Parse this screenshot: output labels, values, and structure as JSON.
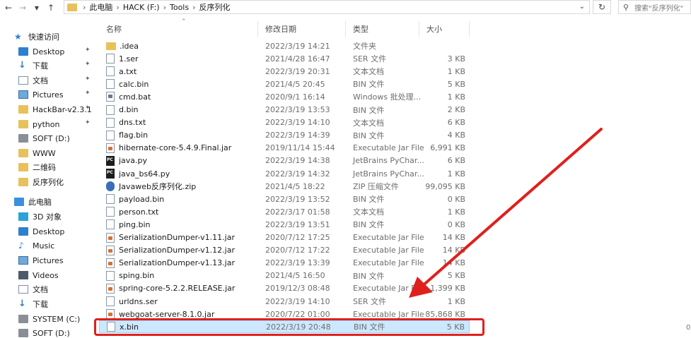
{
  "address_bar": {
    "crumbs": [
      "此电脑",
      "HACK (F:)",
      "Tools",
      "反序列化"
    ],
    "search_placeholder": "搜索\"反序列化\""
  },
  "sidebar": {
    "items": [
      {
        "label": "快速访问",
        "icon": "star-icon",
        "pinned": false
      },
      {
        "label": "Desktop",
        "icon": "desktop-icon",
        "pinned": true
      },
      {
        "label": "下载",
        "icon": "download-icon",
        "pinned": true
      },
      {
        "label": "文档",
        "icon": "documents-icon",
        "pinned": true
      },
      {
        "label": "Pictures",
        "icon": "pictures-icon",
        "pinned": true
      },
      {
        "label": "HackBar-v2.3.1",
        "icon": "folder-icon",
        "pinned": true
      },
      {
        "label": "python",
        "icon": "folder-icon",
        "pinned": true
      },
      {
        "label": "SOFT (D:)",
        "icon": "drive-icon",
        "pinned": false
      },
      {
        "label": "WWW",
        "icon": "folder-icon",
        "pinned": false
      },
      {
        "label": "二维码",
        "icon": "folder-icon",
        "pinned": false
      },
      {
        "label": "反序列化",
        "icon": "folder-icon",
        "pinned": false
      },
      {
        "label": "此电脑",
        "icon": "computer-icon",
        "pinned": false
      },
      {
        "label": "3D 对象",
        "icon": "3d-objects-icon",
        "pinned": false
      },
      {
        "label": "Desktop",
        "icon": "desktop-icon",
        "pinned": false
      },
      {
        "label": "Music",
        "icon": "music-icon",
        "pinned": false
      },
      {
        "label": "Pictures",
        "icon": "pictures-icon",
        "pinned": false
      },
      {
        "label": "Videos",
        "icon": "videos-icon",
        "pinned": false
      },
      {
        "label": "文档",
        "icon": "documents-icon",
        "pinned": false
      },
      {
        "label": "下载",
        "icon": "download-icon",
        "pinned": false
      },
      {
        "label": "SYSTEM (C:)",
        "icon": "drive-icon",
        "pinned": false
      },
      {
        "label": "SOFT (D:)",
        "icon": "drive-icon",
        "pinned": false
      }
    ]
  },
  "columns": {
    "name": "名称",
    "date": "修改日期",
    "type": "类型",
    "size": "大小"
  },
  "files": [
    {
      "name": ".idea",
      "date": "2022/3/19 14:21",
      "type": "文件夹",
      "size": "",
      "icon": "folder"
    },
    {
      "name": "1.ser",
      "date": "2021/4/28 16:47",
      "type": "SER 文件",
      "size": "3 KB",
      "icon": "file"
    },
    {
      "name": "a.txt",
      "date": "2022/3/19 20:31",
      "type": "文本文档",
      "size": "1 KB",
      "icon": "file"
    },
    {
      "name": "calc.bin",
      "date": "2021/4/5 20:45",
      "type": "BIN 文件",
      "size": "5 KB",
      "icon": "file"
    },
    {
      "name": "cmd.bat",
      "date": "2020/9/1 16:14",
      "type": "Windows 批处理...",
      "size": "1 KB",
      "icon": "bat"
    },
    {
      "name": "d.bin",
      "date": "2022/3/19 13:53",
      "type": "BIN 文件",
      "size": "2 KB",
      "icon": "file"
    },
    {
      "name": "dns.txt",
      "date": "2022/3/19 14:10",
      "type": "文本文档",
      "size": "6 KB",
      "icon": "file"
    },
    {
      "name": "flag.bin",
      "date": "2022/3/19 14:39",
      "type": "BIN 文件",
      "size": "4 KB",
      "icon": "file"
    },
    {
      "name": "hibernate-core-5.4.9.Final.jar",
      "date": "2019/11/14 15:44",
      "type": "Executable Jar File",
      "size": "6,991 KB",
      "icon": "jar"
    },
    {
      "name": "java.py",
      "date": "2022/3/19 14:38",
      "type": "JetBrains PyChar...",
      "size": "6 KB",
      "icon": "py"
    },
    {
      "name": "java_bs64.py",
      "date": "2022/3/19 14:32",
      "type": "JetBrains PyChar...",
      "size": "1 KB",
      "icon": "py"
    },
    {
      "name": "Javaweb反序列化.zip",
      "date": "2021/4/5 18:22",
      "type": "ZIP 压缩文件",
      "size": "99,095 KB",
      "icon": "zip"
    },
    {
      "name": "payload.bin",
      "date": "2022/3/19 13:52",
      "type": "BIN 文件",
      "size": "0 KB",
      "icon": "file"
    },
    {
      "name": "person.txt",
      "date": "2022/3/17 01:58",
      "type": "文本文档",
      "size": "1 KB",
      "icon": "file"
    },
    {
      "name": "ping.bin",
      "date": "2022/3/19 13:51",
      "type": "BIN 文件",
      "size": "0 KB",
      "icon": "file"
    },
    {
      "name": "SerializationDumper-v1.11.jar",
      "date": "2020/7/12 17:25",
      "type": "Executable Jar File",
      "size": "14 KB",
      "icon": "jar"
    },
    {
      "name": "SerializationDumper-v1.12.jar",
      "date": "2020/7/12 17:22",
      "type": "Executable Jar File",
      "size": "14 KB",
      "icon": "jar"
    },
    {
      "name": "SerializationDumper-v1.13.jar",
      "date": "2022/3/19 13:39",
      "type": "Executable Jar File",
      "size": "14 KB",
      "icon": "jar"
    },
    {
      "name": "sping.bin",
      "date": "2021/4/5 16:50",
      "type": "BIN 文件",
      "size": "5 KB",
      "icon": "file"
    },
    {
      "name": "spring-core-5.2.2.RELEASE.jar",
      "date": "2019/12/3 08:48",
      "type": "Executable Jar File",
      "size": "1,399 KB",
      "icon": "jar"
    },
    {
      "name": "urldns.ser",
      "date": "2022/3/19 14:10",
      "type": "SER 文件",
      "size": "1 KB",
      "icon": "file"
    },
    {
      "name": "webgoat-server-8.1.0.jar",
      "date": "2020/7/22 01:00",
      "type": "Executable Jar File",
      "size": "85,868 KB",
      "icon": "jar"
    },
    {
      "name": "x.bin",
      "date": "2022/3/19 20:48",
      "type": "BIN 文件",
      "size": "5 KB",
      "icon": "file",
      "selected": true
    }
  ],
  "colors": {
    "selection_bg": "#cce8ff",
    "annotation_red": "#e0201c",
    "folder_yellow": "#e8c15a"
  }
}
